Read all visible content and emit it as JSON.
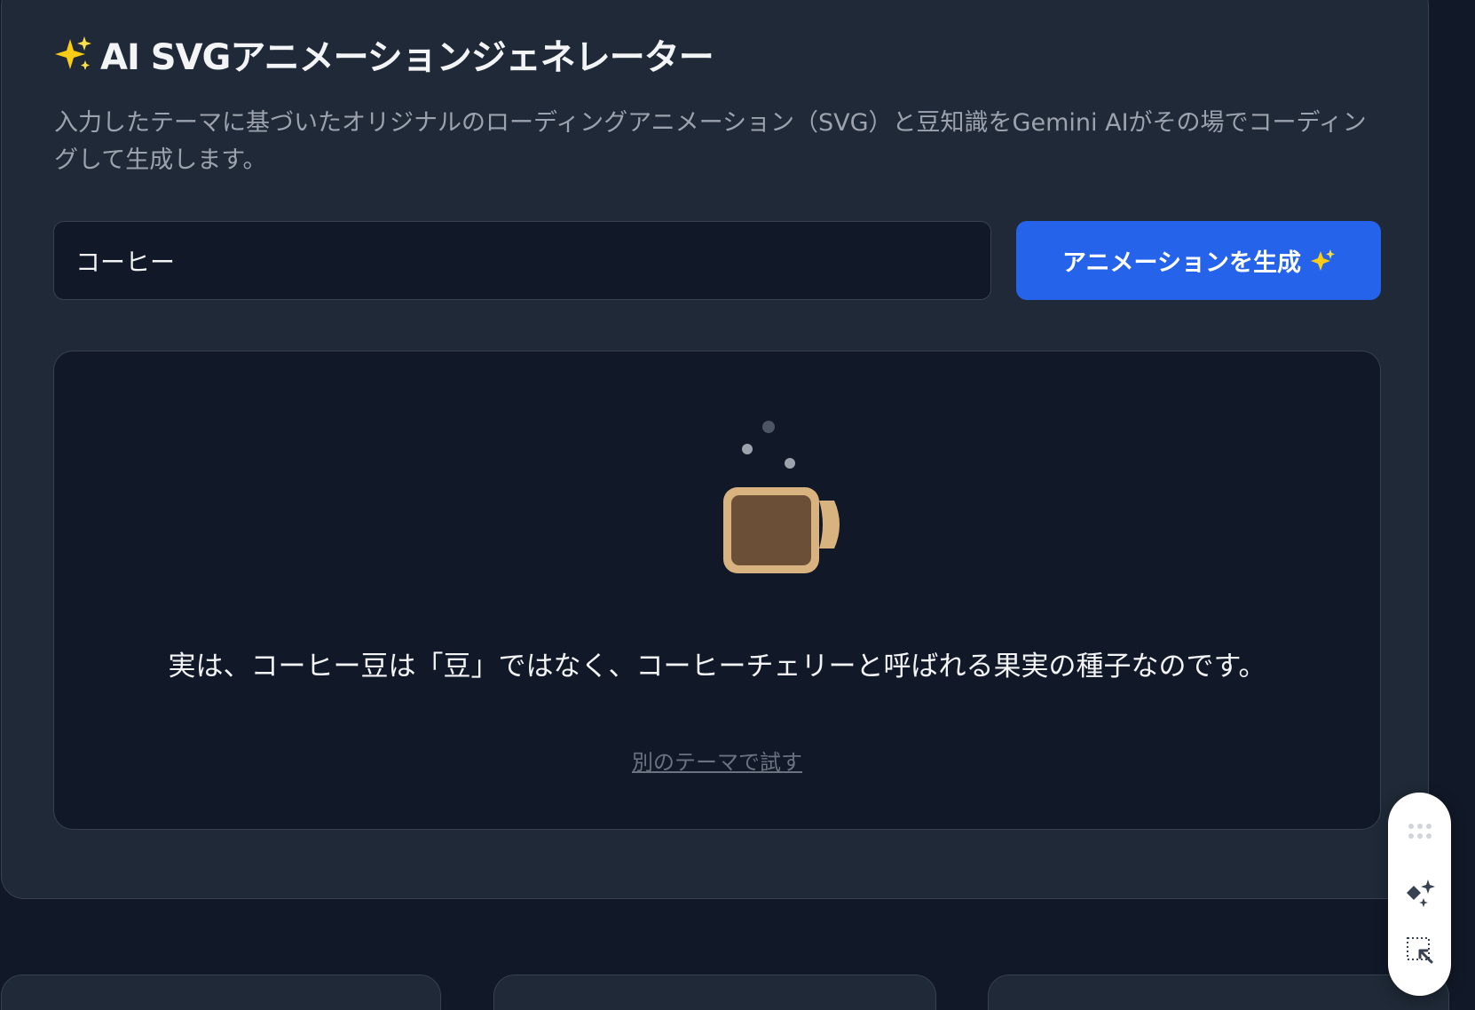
{
  "app": {
    "title": "AI SVGアニメーションジェネレーター",
    "description": "入力したテーマに基づいたオリジナルのローディングアニメーション（SVG）と豆知識をGemini AIがその場でコーディングして生成します。"
  },
  "form": {
    "input_value": "コーヒー",
    "generate_label": "アニメーションを生成"
  },
  "result": {
    "animation_icon": "coffee-mug-icon",
    "fact": "実は、コーヒー豆は「豆」ではなく、コーヒーチェリーと呼ばれる果実の種子なのです。",
    "retry_label": "別のテーマで試す"
  },
  "toolbar": {
    "tools": [
      "drag-handle-icon",
      "ai-sparkle-icon",
      "select-element-icon"
    ]
  },
  "colors": {
    "background": "#111827",
    "card": "#1f2937",
    "accent": "#2563eb",
    "mug_body": "#6b4f37",
    "mug_rim": "#d8b37f",
    "sparkle": "#facc15"
  }
}
